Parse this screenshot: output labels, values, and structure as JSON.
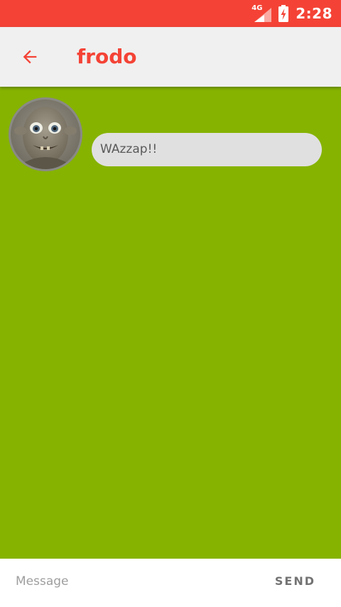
{
  "status_bar": {
    "network": "4G",
    "time": "2:28",
    "icons": [
      "signal-icon",
      "battery-charging-icon"
    ],
    "background": "#f44336"
  },
  "app_bar": {
    "back_icon": "arrow-left-icon",
    "title": "frodo",
    "accent_color": "#f44336",
    "background": "#f0f0f0"
  },
  "conversation": {
    "background": "#86b300",
    "messages": [
      {
        "avatar": "avatar-photo",
        "text": "WAzzap!!"
      }
    ]
  },
  "composer": {
    "placeholder": "Message",
    "value": "",
    "send_label": "SEND"
  }
}
